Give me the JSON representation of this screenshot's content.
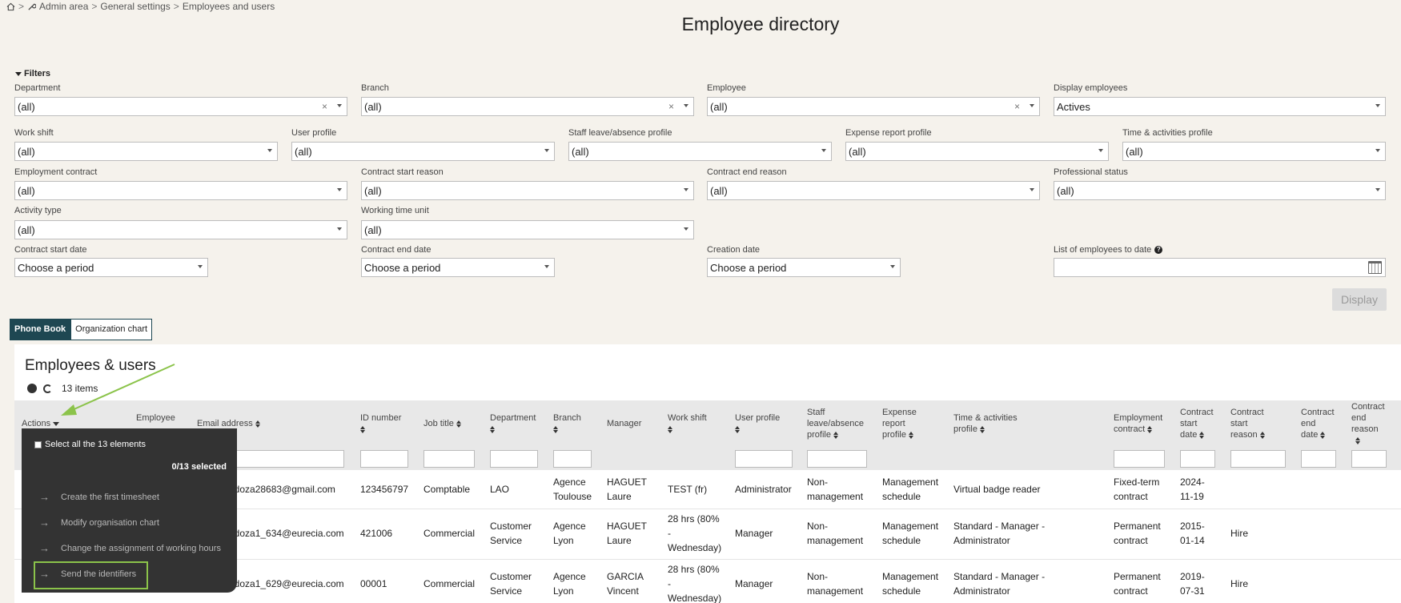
{
  "breadcrumb": {
    "home_icon": "home-icon",
    "sep": ">",
    "admin_icon": "wrench-icon",
    "items": [
      "Admin area",
      "General settings",
      "Employees and users"
    ]
  },
  "page_title": "Employee directory",
  "filters": {
    "toggle_label": "Filters",
    "department": {
      "label": "Department",
      "value": "(all)"
    },
    "branch": {
      "label": "Branch",
      "value": "(all)"
    },
    "employee": {
      "label": "Employee",
      "value": "(all)"
    },
    "display_employees": {
      "label": "Display employees",
      "value": "Actives"
    },
    "work_shift": {
      "label": "Work shift",
      "value": "(all)"
    },
    "user_profile": {
      "label": "User profile",
      "value": "(all)"
    },
    "staff_leave": {
      "label": "Staff leave/absence profile",
      "value": "(all)"
    },
    "expense_profile": {
      "label": "Expense report profile",
      "value": "(all)"
    },
    "time_activities": {
      "label": "Time & activities profile",
      "value": "(all)"
    },
    "employment_contract": {
      "label": "Employment contract",
      "value": "(all)"
    },
    "contract_start_reason": {
      "label": "Contract start reason",
      "value": "(all)"
    },
    "contract_end_reason": {
      "label": "Contract end reason",
      "value": "(all)"
    },
    "professional_status": {
      "label": "Professional status",
      "value": "(all)"
    },
    "activity_type": {
      "label": "Activity type",
      "value": "(all)"
    },
    "working_time_unit": {
      "label": "Working time unit",
      "value": "(all)"
    },
    "contract_start_date": {
      "label": "Contract start date",
      "value": "Choose a period"
    },
    "contract_end_date": {
      "label": "Contract end date",
      "value": "Choose a period"
    },
    "creation_date": {
      "label": "Creation date",
      "value": "Choose a period"
    },
    "list_to_date": {
      "label": "List of employees to date",
      "help_icon": "question-circle-icon",
      "value": ""
    },
    "clear_symbol": "×",
    "display_button": "Display"
  },
  "tabs": [
    {
      "label": "Phone Book",
      "active": true
    },
    {
      "label": "Organization chart",
      "active": false
    }
  ],
  "panel": {
    "title": "Employees & users",
    "item_count": "13 items"
  },
  "table": {
    "columns": {
      "actions": "Actions",
      "employee": "Employee",
      "email": "Email address",
      "id": "ID number",
      "job": "Job title",
      "dept": "Department",
      "branch": "Branch",
      "manager": "Manager",
      "shift": "Work shift",
      "profile": "User profile",
      "leave": [
        "Staff",
        "leave/absence",
        "profile"
      ],
      "expense": [
        "Expense",
        "report",
        "profile"
      ],
      "tap": [
        "Time & activities",
        "profile"
      ],
      "contract": [
        "Employment",
        "contract"
      ],
      "cstart": [
        "Contract",
        "start",
        "date"
      ],
      "creason": [
        "Contract",
        "start",
        "reason"
      ],
      "cend": [
        "Contract",
        "end",
        "date"
      ],
      "cendreason": [
        "Contract",
        "end",
        "reason"
      ]
    },
    "rows": [
      {
        "email": "ndoza28683@gmail.com",
        "id": "123456797",
        "job": "Comptable",
        "dept": [
          "LAO"
        ],
        "branch": [
          "Agence",
          "Toulouse"
        ],
        "manager": [
          "HAGUET",
          "Laure"
        ],
        "shift": [
          "TEST (fr)"
        ],
        "profile": "Administrator",
        "leave": [
          "Non-",
          "management"
        ],
        "expense": [
          "Management",
          "schedule"
        ],
        "tap": [
          "Virtual badge reader"
        ],
        "contract": [
          "Fixed-term",
          "contract"
        ],
        "cstart": [
          "2024-",
          "11-19"
        ],
        "creason": ""
      },
      {
        "email": "ndoza1_634@eurecia.com",
        "id": "421006",
        "job": "Commercial",
        "dept": [
          "Customer",
          "Service"
        ],
        "branch": [
          "Agence",
          "Lyon"
        ],
        "manager": [
          "HAGUET",
          "Laure"
        ],
        "shift": [
          "28 hrs (80%",
          "-",
          "Wednesday)"
        ],
        "profile": "Manager",
        "leave": [
          "Non-",
          "management"
        ],
        "expense": [
          "Management",
          "schedule"
        ],
        "tap": [
          "Standard - Manager -",
          "Administrator"
        ],
        "contract": [
          "Permanent",
          "contract"
        ],
        "cstart": [
          "2015-",
          "01-14"
        ],
        "creason": "Hire"
      },
      {
        "email": "ndoza1_629@eurecia.com",
        "id": "00001",
        "job": "Commercial",
        "dept": [
          "Customer",
          "Service"
        ],
        "branch": [
          "Agence",
          "Lyon"
        ],
        "manager": [
          "GARCIA",
          "Vincent"
        ],
        "shift": [
          "28 hrs (80%",
          "-",
          "Wednesday)"
        ],
        "profile": "Manager",
        "leave": [
          "Non-",
          "management"
        ],
        "expense": [
          "Management",
          "schedule"
        ],
        "tap": [
          "Standard - Manager -",
          "Administrator"
        ],
        "contract": [
          "Permanent",
          "contract"
        ],
        "cstart": [
          "2019-",
          "07-31"
        ],
        "creason": "Hire"
      }
    ]
  },
  "actions_menu": {
    "select_all": "Select all the 13 elements",
    "selected_count": "0/13 selected",
    "items": [
      "Create the first timesheet",
      "Modify organisation chart",
      "Change the assignment of working hours",
      "Send the identifiers"
    ],
    "arrow": "→"
  },
  "colors": {
    "accent": "#1e4752",
    "annotation": "#8bc34a"
  }
}
